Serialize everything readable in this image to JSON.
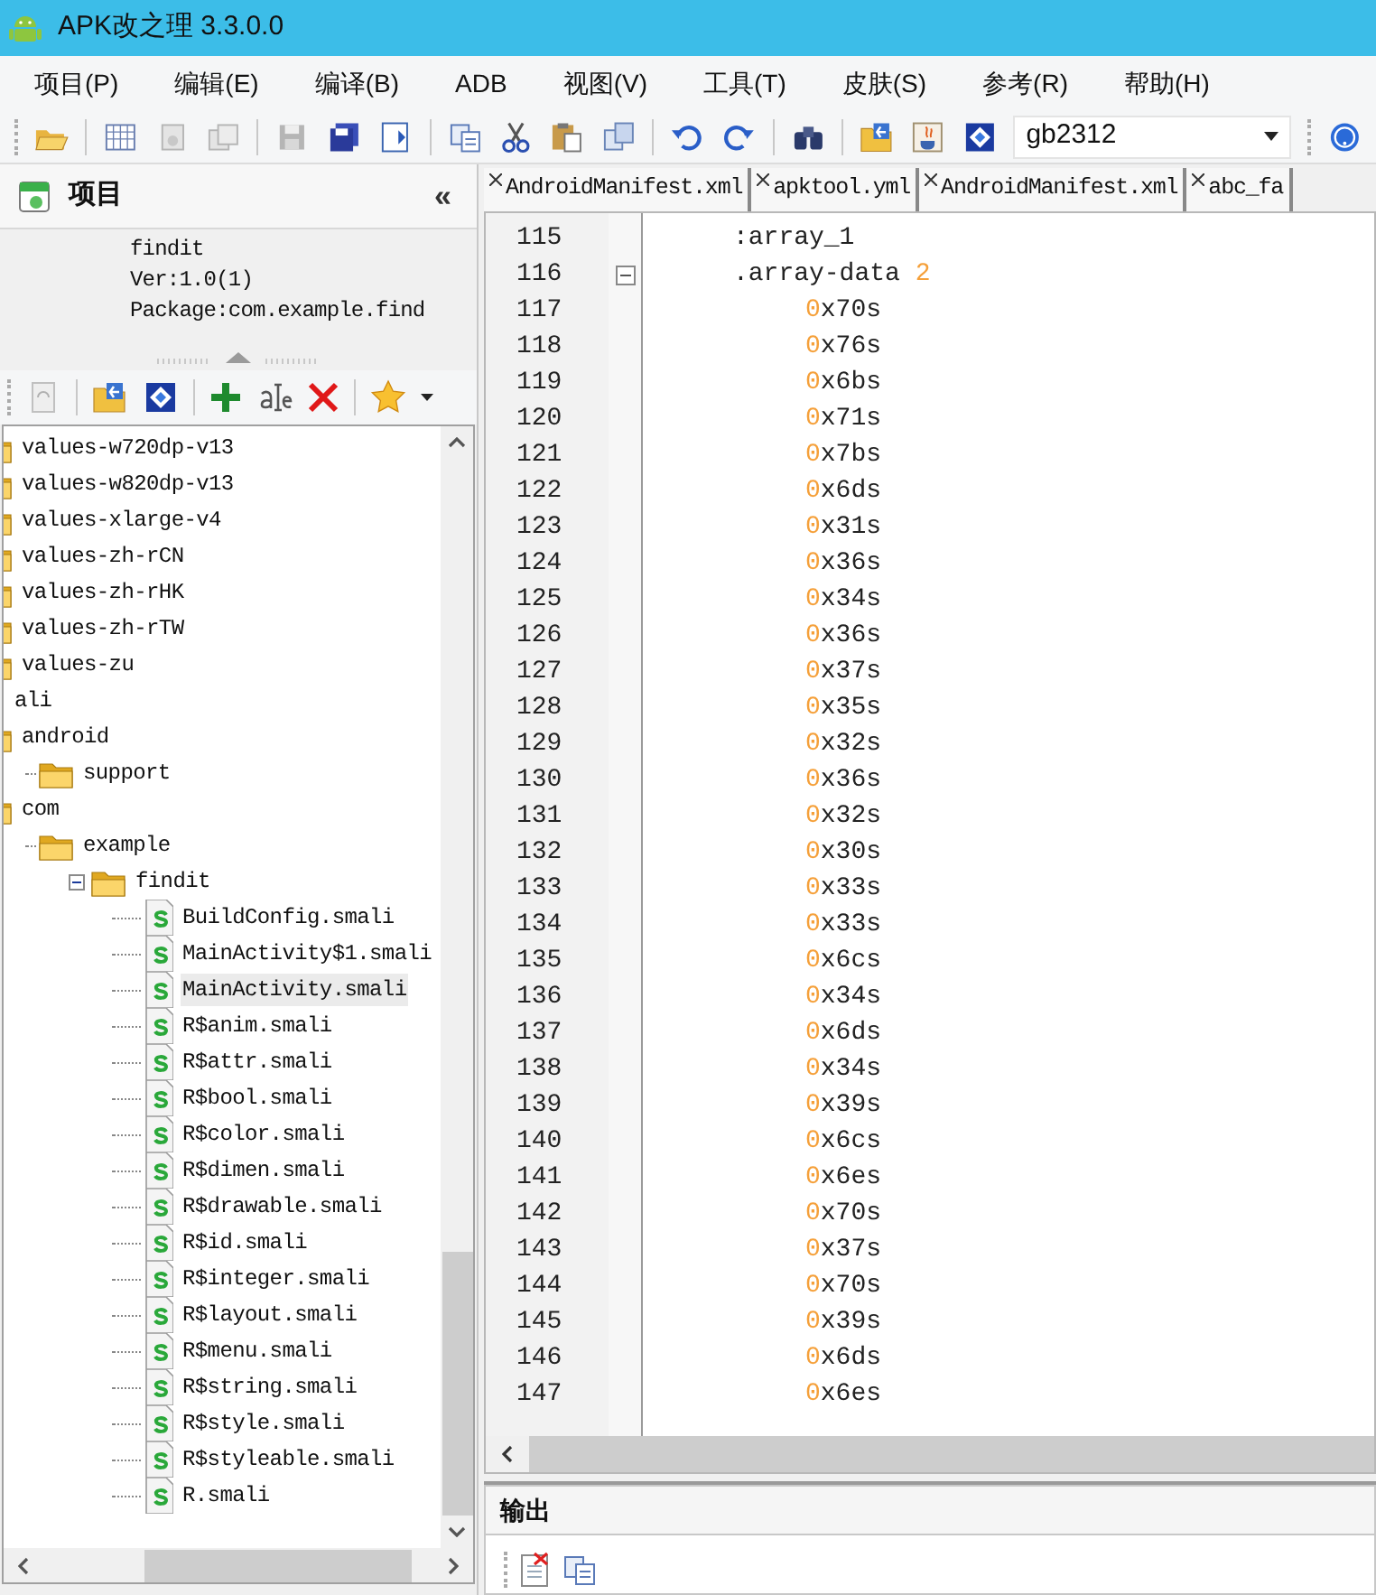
{
  "window": {
    "title": "APK改之理 3.3.0.0"
  },
  "menu": [
    "项目(P)",
    "编辑(E)",
    "编译(B)",
    "ADB",
    "视图(V)",
    "工具(T)",
    "皮肤(S)",
    "参考(R)",
    "帮助(H)"
  ],
  "toolbar": {
    "encoding": "gb2312"
  },
  "project_panel": {
    "title": "项目",
    "collapse": "«",
    "info": [
      "findit",
      "Ver:1.0(1)",
      "Package:com.example.find"
    ],
    "tree": [
      {
        "label": "values-w720dp-v13",
        "kind": "folder"
      },
      {
        "label": "values-w820dp-v13",
        "kind": "folder"
      },
      {
        "label": "values-xlarge-v4",
        "kind": "folder"
      },
      {
        "label": "values-zh-rCN",
        "kind": "folder"
      },
      {
        "label": "values-zh-rHK",
        "kind": "folder"
      },
      {
        "label": "values-zh-rTW",
        "kind": "folder"
      },
      {
        "label": "values-zu",
        "kind": "folder"
      },
      {
        "label": "ali",
        "kind": "plain"
      },
      {
        "label": "android",
        "kind": "folder",
        "children": [
          {
            "label": "support",
            "kind": "folder"
          }
        ]
      },
      {
        "label": "com",
        "kind": "folder",
        "children": [
          {
            "label": "example",
            "kind": "folder",
            "children": [
              {
                "label": "findit",
                "kind": "folder",
                "expanded": true,
                "children": [
                  {
                    "label": "BuildConfig.smali",
                    "kind": "smali",
                    "selected": false
                  },
                  {
                    "label": "MainActivity$1.smali",
                    "kind": "smali",
                    "selected": false
                  },
                  {
                    "label": "MainActivity.smali",
                    "kind": "smali",
                    "selected": true
                  },
                  {
                    "label": "R$anim.smali",
                    "kind": "smali",
                    "selected": false
                  },
                  {
                    "label": "R$attr.smali",
                    "kind": "smali",
                    "selected": false
                  },
                  {
                    "label": "R$bool.smali",
                    "kind": "smali",
                    "selected": false
                  },
                  {
                    "label": "R$color.smali",
                    "kind": "smali",
                    "selected": false
                  },
                  {
                    "label": "R$dimen.smali",
                    "kind": "smali",
                    "selected": false
                  },
                  {
                    "label": "R$drawable.smali",
                    "kind": "smali",
                    "selected": false
                  },
                  {
                    "label": "R$id.smali",
                    "kind": "smali",
                    "selected": false
                  },
                  {
                    "label": "R$integer.smali",
                    "kind": "smali",
                    "selected": false
                  },
                  {
                    "label": "R$layout.smali",
                    "kind": "smali",
                    "selected": false
                  },
                  {
                    "label": "R$menu.smali",
                    "kind": "smali",
                    "selected": false
                  },
                  {
                    "label": "R$string.smali",
                    "kind": "smali",
                    "selected": false
                  },
                  {
                    "label": "R$style.smali",
                    "kind": "smali",
                    "selected": false
                  },
                  {
                    "label": "R$styleable.smali",
                    "kind": "smali",
                    "selected": false
                  },
                  {
                    "label": "R.smali",
                    "kind": "smali",
                    "selected": false
                  }
                ]
              }
            ]
          }
        ]
      }
    ]
  },
  "tabs": [
    "AndroidManifest.xml",
    "apktool.yml",
    "AndroidManifest.xml",
    "abc_fa"
  ],
  "editor": {
    "lines": [
      {
        "number": "115",
        "kind": "directive",
        "tokens": [
          {
            "text": ":array_1",
            "kind": "plain"
          }
        ]
      },
      {
        "number": "116",
        "kind": "directive",
        "foldable": true,
        "tokens": [
          {
            "text": ".array-data ",
            "kind": "plain"
          },
          {
            "text": "2",
            "kind": "number"
          }
        ]
      },
      {
        "number": "117",
        "kind": "value",
        "tokens": [
          {
            "text": "0",
            "kind": "number"
          },
          {
            "text": "x70s",
            "kind": "plain"
          }
        ]
      },
      {
        "number": "118",
        "kind": "value",
        "tokens": [
          {
            "text": "0",
            "kind": "number"
          },
          {
            "text": "x76s",
            "kind": "plain"
          }
        ]
      },
      {
        "number": "119",
        "kind": "value",
        "tokens": [
          {
            "text": "0",
            "kind": "number"
          },
          {
            "text": "x6bs",
            "kind": "plain"
          }
        ]
      },
      {
        "number": "120",
        "kind": "value",
        "tokens": [
          {
            "text": "0",
            "kind": "number"
          },
          {
            "text": "x71s",
            "kind": "plain"
          }
        ]
      },
      {
        "number": "121",
        "kind": "value",
        "tokens": [
          {
            "text": "0",
            "kind": "number"
          },
          {
            "text": "x7bs",
            "kind": "plain"
          }
        ]
      },
      {
        "number": "122",
        "kind": "value",
        "tokens": [
          {
            "text": "0",
            "kind": "number"
          },
          {
            "text": "x6ds",
            "kind": "plain"
          }
        ]
      },
      {
        "number": "123",
        "kind": "value",
        "tokens": [
          {
            "text": "0",
            "kind": "number"
          },
          {
            "text": "x31s",
            "kind": "plain"
          }
        ]
      },
      {
        "number": "124",
        "kind": "value",
        "tokens": [
          {
            "text": "0",
            "kind": "number"
          },
          {
            "text": "x36s",
            "kind": "plain"
          }
        ]
      },
      {
        "number": "125",
        "kind": "value",
        "tokens": [
          {
            "text": "0",
            "kind": "number"
          },
          {
            "text": "x34s",
            "kind": "plain"
          }
        ]
      },
      {
        "number": "126",
        "kind": "value",
        "tokens": [
          {
            "text": "0",
            "kind": "number"
          },
          {
            "text": "x36s",
            "kind": "plain"
          }
        ]
      },
      {
        "number": "127",
        "kind": "value",
        "tokens": [
          {
            "text": "0",
            "kind": "number"
          },
          {
            "text": "x37s",
            "kind": "plain"
          }
        ]
      },
      {
        "number": "128",
        "kind": "value",
        "tokens": [
          {
            "text": "0",
            "kind": "number"
          },
          {
            "text": "x35s",
            "kind": "plain"
          }
        ]
      },
      {
        "number": "129",
        "kind": "value",
        "tokens": [
          {
            "text": "0",
            "kind": "number"
          },
          {
            "text": "x32s",
            "kind": "plain"
          }
        ]
      },
      {
        "number": "130",
        "kind": "value",
        "tokens": [
          {
            "text": "0",
            "kind": "number"
          },
          {
            "text": "x36s",
            "kind": "plain"
          }
        ]
      },
      {
        "number": "131",
        "kind": "value",
        "tokens": [
          {
            "text": "0",
            "kind": "number"
          },
          {
            "text": "x32s",
            "kind": "plain"
          }
        ]
      },
      {
        "number": "132",
        "kind": "value",
        "tokens": [
          {
            "text": "0",
            "kind": "number"
          },
          {
            "text": "x30s",
            "kind": "plain"
          }
        ]
      },
      {
        "number": "133",
        "kind": "value",
        "tokens": [
          {
            "text": "0",
            "kind": "number"
          },
          {
            "text": "x33s",
            "kind": "plain"
          }
        ]
      },
      {
        "number": "134",
        "kind": "value",
        "tokens": [
          {
            "text": "0",
            "kind": "number"
          },
          {
            "text": "x33s",
            "kind": "plain"
          }
        ]
      },
      {
        "number": "135",
        "kind": "value",
        "tokens": [
          {
            "text": "0",
            "kind": "number"
          },
          {
            "text": "x6cs",
            "kind": "plain"
          }
        ]
      },
      {
        "number": "136",
        "kind": "value",
        "tokens": [
          {
            "text": "0",
            "kind": "number"
          },
          {
            "text": "x34s",
            "kind": "plain"
          }
        ]
      },
      {
        "number": "137",
        "kind": "value",
        "tokens": [
          {
            "text": "0",
            "kind": "number"
          },
          {
            "text": "x6ds",
            "kind": "plain"
          }
        ]
      },
      {
        "number": "138",
        "kind": "value",
        "tokens": [
          {
            "text": "0",
            "kind": "number"
          },
          {
            "text": "x34s",
            "kind": "plain"
          }
        ]
      },
      {
        "number": "139",
        "kind": "value",
        "tokens": [
          {
            "text": "0",
            "kind": "number"
          },
          {
            "text": "x39s",
            "kind": "plain"
          }
        ]
      },
      {
        "number": "140",
        "kind": "value",
        "tokens": [
          {
            "text": "0",
            "kind": "number"
          },
          {
            "text": "x6cs",
            "kind": "plain"
          }
        ]
      },
      {
        "number": "141",
        "kind": "value",
        "tokens": [
          {
            "text": "0",
            "kind": "number"
          },
          {
            "text": "x6es",
            "kind": "plain"
          }
        ]
      },
      {
        "number": "142",
        "kind": "value",
        "tokens": [
          {
            "text": "0",
            "kind": "number"
          },
          {
            "text": "x70s",
            "kind": "plain"
          }
        ]
      },
      {
        "number": "143",
        "kind": "value",
        "tokens": [
          {
            "text": "0",
            "kind": "number"
          },
          {
            "text": "x37s",
            "kind": "plain"
          }
        ]
      },
      {
        "number": "144",
        "kind": "value",
        "tokens": [
          {
            "text": "0",
            "kind": "number"
          },
          {
            "text": "x70s",
            "kind": "plain"
          }
        ]
      },
      {
        "number": "145",
        "kind": "value",
        "tokens": [
          {
            "text": "0",
            "kind": "number"
          },
          {
            "text": "x39s",
            "kind": "plain"
          }
        ]
      },
      {
        "number": "146",
        "kind": "value",
        "tokens": [
          {
            "text": "0",
            "kind": "number"
          },
          {
            "text": "x6ds",
            "kind": "plain"
          }
        ]
      },
      {
        "number": "147",
        "kind": "value",
        "tokens": [
          {
            "text": "0",
            "kind": "number"
          },
          {
            "text": "x6es",
            "kind": "plain"
          }
        ]
      }
    ]
  },
  "output_panel": {
    "title": "输出"
  }
}
